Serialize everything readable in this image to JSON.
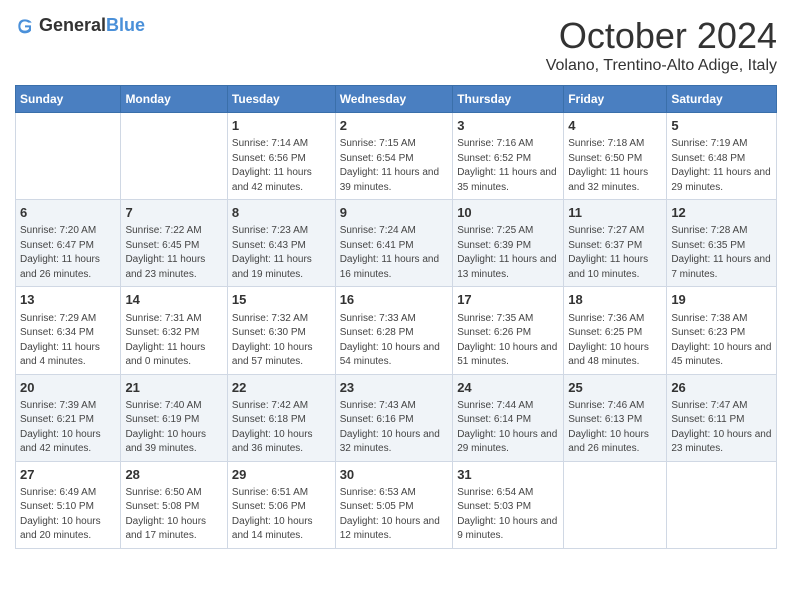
{
  "logo": {
    "text_general": "General",
    "text_blue": "Blue"
  },
  "header": {
    "month": "October 2024",
    "location": "Volano, Trentino-Alto Adige, Italy"
  },
  "days_of_week": [
    "Sunday",
    "Monday",
    "Tuesday",
    "Wednesday",
    "Thursday",
    "Friday",
    "Saturday"
  ],
  "weeks": [
    [
      {
        "day": "",
        "info": ""
      },
      {
        "day": "",
        "info": ""
      },
      {
        "day": "1",
        "info": "Sunrise: 7:14 AM\nSunset: 6:56 PM\nDaylight: 11 hours and 42 minutes."
      },
      {
        "day": "2",
        "info": "Sunrise: 7:15 AM\nSunset: 6:54 PM\nDaylight: 11 hours and 39 minutes."
      },
      {
        "day": "3",
        "info": "Sunrise: 7:16 AM\nSunset: 6:52 PM\nDaylight: 11 hours and 35 minutes."
      },
      {
        "day": "4",
        "info": "Sunrise: 7:18 AM\nSunset: 6:50 PM\nDaylight: 11 hours and 32 minutes."
      },
      {
        "day": "5",
        "info": "Sunrise: 7:19 AM\nSunset: 6:48 PM\nDaylight: 11 hours and 29 minutes."
      }
    ],
    [
      {
        "day": "6",
        "info": "Sunrise: 7:20 AM\nSunset: 6:47 PM\nDaylight: 11 hours and 26 minutes."
      },
      {
        "day": "7",
        "info": "Sunrise: 7:22 AM\nSunset: 6:45 PM\nDaylight: 11 hours and 23 minutes."
      },
      {
        "day": "8",
        "info": "Sunrise: 7:23 AM\nSunset: 6:43 PM\nDaylight: 11 hours and 19 minutes."
      },
      {
        "day": "9",
        "info": "Sunrise: 7:24 AM\nSunset: 6:41 PM\nDaylight: 11 hours and 16 minutes."
      },
      {
        "day": "10",
        "info": "Sunrise: 7:25 AM\nSunset: 6:39 PM\nDaylight: 11 hours and 13 minutes."
      },
      {
        "day": "11",
        "info": "Sunrise: 7:27 AM\nSunset: 6:37 PM\nDaylight: 11 hours and 10 minutes."
      },
      {
        "day": "12",
        "info": "Sunrise: 7:28 AM\nSunset: 6:35 PM\nDaylight: 11 hours and 7 minutes."
      }
    ],
    [
      {
        "day": "13",
        "info": "Sunrise: 7:29 AM\nSunset: 6:34 PM\nDaylight: 11 hours and 4 minutes."
      },
      {
        "day": "14",
        "info": "Sunrise: 7:31 AM\nSunset: 6:32 PM\nDaylight: 11 hours and 0 minutes."
      },
      {
        "day": "15",
        "info": "Sunrise: 7:32 AM\nSunset: 6:30 PM\nDaylight: 10 hours and 57 minutes."
      },
      {
        "day": "16",
        "info": "Sunrise: 7:33 AM\nSunset: 6:28 PM\nDaylight: 10 hours and 54 minutes."
      },
      {
        "day": "17",
        "info": "Sunrise: 7:35 AM\nSunset: 6:26 PM\nDaylight: 10 hours and 51 minutes."
      },
      {
        "day": "18",
        "info": "Sunrise: 7:36 AM\nSunset: 6:25 PM\nDaylight: 10 hours and 48 minutes."
      },
      {
        "day": "19",
        "info": "Sunrise: 7:38 AM\nSunset: 6:23 PM\nDaylight: 10 hours and 45 minutes."
      }
    ],
    [
      {
        "day": "20",
        "info": "Sunrise: 7:39 AM\nSunset: 6:21 PM\nDaylight: 10 hours and 42 minutes."
      },
      {
        "day": "21",
        "info": "Sunrise: 7:40 AM\nSunset: 6:19 PM\nDaylight: 10 hours and 39 minutes."
      },
      {
        "day": "22",
        "info": "Sunrise: 7:42 AM\nSunset: 6:18 PM\nDaylight: 10 hours and 36 minutes."
      },
      {
        "day": "23",
        "info": "Sunrise: 7:43 AM\nSunset: 6:16 PM\nDaylight: 10 hours and 32 minutes."
      },
      {
        "day": "24",
        "info": "Sunrise: 7:44 AM\nSunset: 6:14 PM\nDaylight: 10 hours and 29 minutes."
      },
      {
        "day": "25",
        "info": "Sunrise: 7:46 AM\nSunset: 6:13 PM\nDaylight: 10 hours and 26 minutes."
      },
      {
        "day": "26",
        "info": "Sunrise: 7:47 AM\nSunset: 6:11 PM\nDaylight: 10 hours and 23 minutes."
      }
    ],
    [
      {
        "day": "27",
        "info": "Sunrise: 6:49 AM\nSunset: 5:10 PM\nDaylight: 10 hours and 20 minutes."
      },
      {
        "day": "28",
        "info": "Sunrise: 6:50 AM\nSunset: 5:08 PM\nDaylight: 10 hours and 17 minutes."
      },
      {
        "day": "29",
        "info": "Sunrise: 6:51 AM\nSunset: 5:06 PM\nDaylight: 10 hours and 14 minutes."
      },
      {
        "day": "30",
        "info": "Sunrise: 6:53 AM\nSunset: 5:05 PM\nDaylight: 10 hours and 12 minutes."
      },
      {
        "day": "31",
        "info": "Sunrise: 6:54 AM\nSunset: 5:03 PM\nDaylight: 10 hours and 9 minutes."
      },
      {
        "day": "",
        "info": ""
      },
      {
        "day": "",
        "info": ""
      }
    ]
  ]
}
